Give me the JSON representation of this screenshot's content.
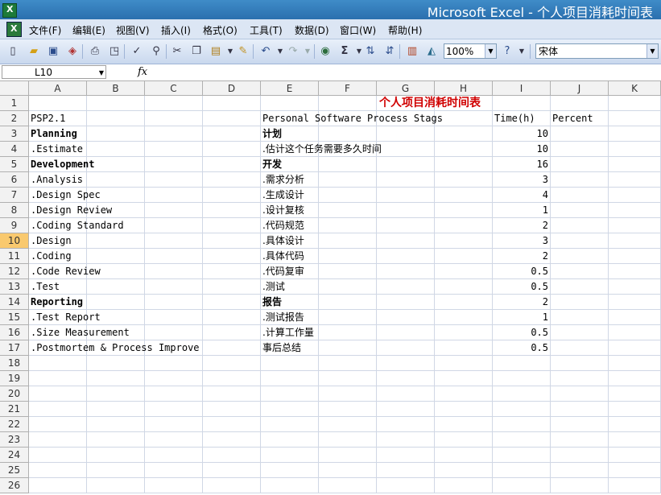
{
  "window": {
    "title": "Microsoft Excel - 个人项目消耗时间表",
    "app_icon_glyph": "X"
  },
  "menu": [
    "文件(F)",
    "编辑(E)",
    "视图(V)",
    "插入(I)",
    "格式(O)",
    "工具(T)",
    "数据(D)",
    "窗口(W)",
    "帮助(H)"
  ],
  "toolbar": {
    "zoom": "100%",
    "font": "宋体"
  },
  "formula_bar": {
    "name_box": "L10",
    "fx_label": "fx"
  },
  "columns": [
    "A",
    "B",
    "C",
    "D",
    "E",
    "F",
    "G",
    "H",
    "I",
    "J",
    "K"
  ],
  "rows": [
    "1",
    "2",
    "3",
    "4",
    "5",
    "6",
    "7",
    "8",
    "9",
    "10",
    "11",
    "12",
    "13",
    "14",
    "15",
    "16",
    "17",
    "18",
    "19",
    "20",
    "21",
    "22",
    "23",
    "24",
    "25",
    "26"
  ],
  "selected_row": "10",
  "sheet": {
    "title": "个人项目消耗时间表",
    "header": {
      "a": "PSP2.1",
      "e": "Personal Software Process Stags",
      "i": "Time(h)",
      "j": "Percent"
    },
    "rows": [
      {
        "a": "Planning",
        "e": "计划",
        "i": "10",
        "bold": true
      },
      {
        "a": ".Estimate",
        "e": ".估计这个任务需要多久时间",
        "i": "10",
        "bold": false
      },
      {
        "a": "Development",
        "e": "开发",
        "i": "16",
        "bold": true
      },
      {
        "a": ".Analysis",
        "e": ".需求分析",
        "i": "3",
        "bold": false
      },
      {
        "a": ".Design Spec",
        "e": ".生成设计",
        "i": "4",
        "bold": false
      },
      {
        "a": ".Design Review",
        "e": ".设计复核",
        "i": "1",
        "bold": false
      },
      {
        "a": ".Coding Standard",
        "e": ".代码规范",
        "i": "2",
        "bold": false
      },
      {
        "a": ".Design",
        "e": ".具体设计",
        "i": "3",
        "bold": false
      },
      {
        "a": ".Coding",
        "e": ".具体代码",
        "i": "2",
        "bold": false
      },
      {
        "a": ".Code Review",
        "e": ".代码复审",
        "i": "0.5",
        "bold": false
      },
      {
        "a": ".Test",
        "e": ".测试",
        "i": "0.5",
        "bold": false
      },
      {
        "a": "Reporting",
        "e": "报告",
        "i": "2",
        "bold": true
      },
      {
        "a": ".Test Report",
        "e": ".测试报告",
        "i": "1",
        "bold": false
      },
      {
        "a": ".Size Measurement",
        "e": ".计算工作量",
        "i": "0.5",
        "bold": false
      },
      {
        "a": ".Postmortem & Process Improve",
        "e": "事后总结",
        "i": "0.5",
        "bold": false
      }
    ]
  },
  "colors": {
    "title_red": "#d00000",
    "selected_row_header": "#f9c96e",
    "titlebar": "#2a6fae"
  }
}
